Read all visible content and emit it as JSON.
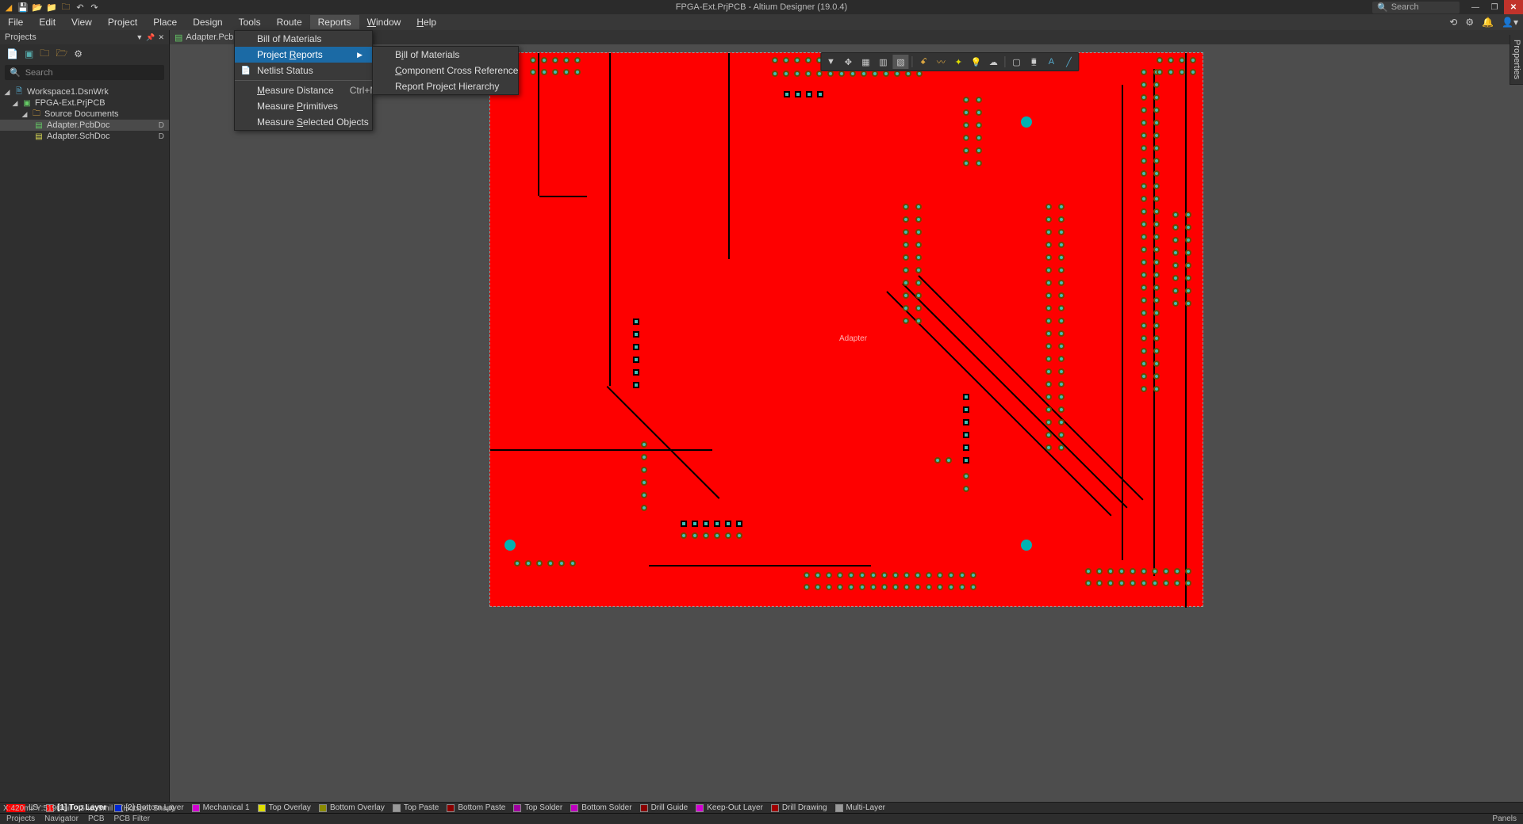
{
  "title": "FPGA-Ext.PrjPCB - Altium Designer (19.0.4)",
  "search_placeholder": "Search",
  "menubar": [
    "File",
    "Edit",
    "View",
    "Project",
    "Place",
    "Design",
    "Tools",
    "Route",
    "Reports",
    "Window",
    "Help"
  ],
  "active_menu": "Reports",
  "reports_menu": {
    "bom": "Bill of Materials",
    "project_reports": "Project Reports",
    "netlist_status": "Netlist Status",
    "measure_distance": "Measure Distance",
    "measure_distance_shortcut": "Ctrl+M",
    "measure_primitives": "Measure Primitives",
    "measure_selected": "Measure Selected Objects"
  },
  "project_reports_submenu": {
    "bom": "Bill of Materials",
    "ccr": "Component Cross Reference",
    "hierarchy": "Report Project Hierarchy"
  },
  "projects_panel": {
    "title": "Projects",
    "search_placeholder": "Search",
    "tree": {
      "workspace": "Workspace1.DsnWrk",
      "project": "FPGA-Ext.PrjPCB",
      "group": "Source Documents",
      "doc1": "Adapter.PcbDoc",
      "doc2": "Adapter.SchDoc",
      "flag": "D"
    }
  },
  "doc_tab": "Adapter.PcbDoc",
  "board_label": "Adapter",
  "side_tab": "Properties",
  "layers": [
    {
      "name": "LS",
      "color": "#fe0000",
      "bold": false,
      "lead": true
    },
    {
      "name": "[1] Top Layer",
      "color": "#fe0000",
      "bold": true
    },
    {
      "name": "[2] Bottom Layer",
      "color": "#0028d2"
    },
    {
      "name": "Mechanical 1",
      "color": "#d200d2"
    },
    {
      "name": "Top Overlay",
      "color": "#dede00"
    },
    {
      "name": "Bottom Overlay",
      "color": "#8a8a00"
    },
    {
      "name": "Top Paste",
      "color": "#999999"
    },
    {
      "name": "Bottom Paste",
      "color": "#8a0000"
    },
    {
      "name": "Top Solder",
      "color": "#a000a0"
    },
    {
      "name": "Bottom Solder",
      "color": "#c000c0"
    },
    {
      "name": "Drill Guide",
      "color": "#8a0000"
    },
    {
      "name": "Keep-Out Layer",
      "color": "#d200d2"
    },
    {
      "name": "Drill Drawing",
      "color": "#a00000"
    },
    {
      "name": "Multi-Layer",
      "color": "#999999"
    }
  ],
  "panels": [
    "Projects",
    "Navigator",
    "PCB",
    "PCB Filter"
  ],
  "panels_right": "Panels",
  "status": {
    "coord": "X:420mil Y:5190mil",
    "grid": "Grid: 5mil",
    "snap": "(Hotspot Snap)"
  }
}
